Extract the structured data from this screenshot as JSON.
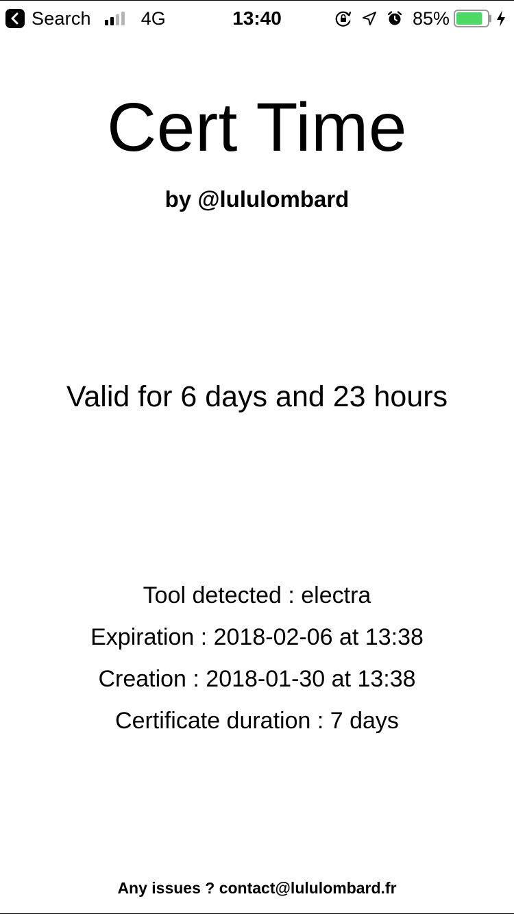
{
  "status_bar": {
    "back_label": "Search",
    "network": "4G",
    "time": "13:40",
    "battery_percent": "85%",
    "battery_level": 0.85,
    "battery_color": "#4cd964",
    "signal_bars_filled": 2,
    "signal_bars_total": 4
  },
  "app": {
    "title": "Cert Time",
    "byline": "by @lululombard",
    "validity": "Valid for 6 days and 23 hours",
    "details": {
      "tool": "Tool detected : electra",
      "expiration": "Expiration : 2018-02-06 at 13:38",
      "creation": "Creation : 2018-01-30 at 13:38",
      "duration": "Certificate duration : 7 days"
    },
    "footer": "Any issues ? contact@lululombard.fr"
  }
}
